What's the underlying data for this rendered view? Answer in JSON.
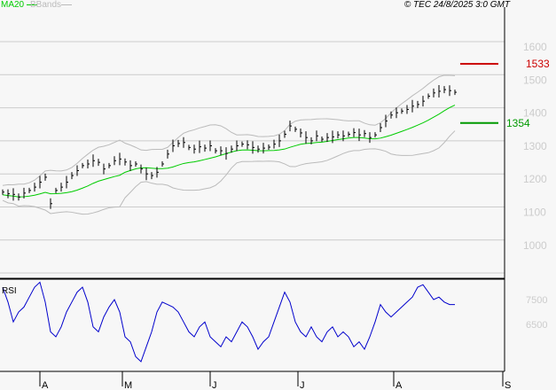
{
  "header": {
    "ma_legend": "MA20",
    "bbands_legend": "BBands",
    "copyright": "© TEC 24/8/2025 3:0 GMT"
  },
  "levels": {
    "resistance": "1533",
    "support": "1354",
    "resistance_value": 1533,
    "support_value": 1354,
    "resistance_color": "#cc0000",
    "support_color": "#009900"
  },
  "chart_data": {
    "type": "line",
    "title": "",
    "price_ylim": [
      950,
      1650
    ],
    "price_ticks": [
      "1600",
      "1500",
      "1400",
      "1300",
      "1200",
      "1100",
      "1000"
    ],
    "price_tick_values": [
      1600,
      1500,
      1400,
      1300,
      1200,
      1100,
      1000
    ],
    "rsi_label": "RSI",
    "rsi_ylim": [
      45,
      85
    ],
    "rsi_ticks": [
      "7500",
      "6500"
    ],
    "rsi_tick_values": [
      75,
      65
    ],
    "x_ticks": [
      "A",
      "M",
      "J",
      "J",
      "A",
      "S"
    ],
    "x_tick_index": [
      7,
      22.5,
      39,
      55.5,
      73.5,
      94
    ],
    "closes": [
      1145,
      1140,
      1138,
      1130,
      1142,
      1150,
      1160,
      1175,
      1190,
      1110,
      1150,
      1160,
      1175,
      1195,
      1210,
      1225,
      1230,
      1240,
      1235,
      1215,
      1225,
      1240,
      1245,
      1236,
      1225,
      1230,
      1215,
      1200,
      1195,
      1205,
      1230,
      1260,
      1285,
      1292,
      1295,
      1280,
      1275,
      1282,
      1278,
      1285,
      1270,
      1270,
      1262,
      1275,
      1285,
      1290,
      1288,
      1280,
      1275,
      1278,
      1281,
      1290,
      1300,
      1320,
      1345,
      1335,
      1324,
      1310,
      1300,
      1315,
      1305,
      1310,
      1312,
      1318,
      1315,
      1320,
      1325,
      1318,
      1322,
      1310,
      1318,
      1340,
      1360,
      1378,
      1385,
      1390,
      1395,
      1405,
      1410,
      1420,
      1435,
      1445,
      1450,
      1455,
      1452,
      1447
    ],
    "rsi": [
      80,
      74,
      66,
      70,
      72,
      76,
      80,
      82,
      74,
      62,
      60,
      64,
      70,
      74,
      78,
      80,
      74,
      64,
      62,
      68,
      72,
      75,
      70,
      60,
      58,
      52,
      50,
      56,
      62,
      70,
      74,
      73,
      72,
      70,
      66,
      62,
      60,
      64,
      66,
      60,
      58,
      56,
      60,
      58,
      62,
      66,
      64,
      60,
      55,
      58,
      60,
      66,
      72,
      78,
      74,
      66,
      62,
      60,
      64,
      60,
      58,
      62,
      64,
      60,
      62,
      60,
      56,
      58,
      55,
      60,
      66,
      73,
      70,
      68,
      70,
      72,
      74,
      76,
      80,
      81,
      78,
      75,
      76,
      74,
      73,
      73
    ]
  }
}
